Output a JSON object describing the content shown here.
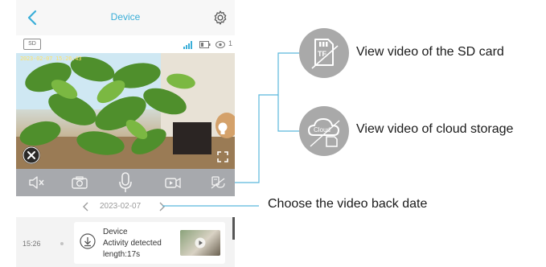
{
  "header": {
    "title": "Device",
    "back_icon": "chevron-left-icon",
    "settings_icon": "gear-icon"
  },
  "status": {
    "sd_label": "SD",
    "viewer_count": "1"
  },
  "video": {
    "timestamp": "2023-02-07 15:26:43"
  },
  "toolbar": {
    "icons": [
      "speaker-mute-icon",
      "camera-icon",
      "microphone-icon",
      "video-record-icon",
      "playback-icon"
    ]
  },
  "date_nav": {
    "date": "2023-02-07"
  },
  "events": [
    {
      "time": "15:26",
      "device": "Device",
      "description": "Activity detected",
      "length": "length:17s"
    }
  ],
  "callouts": {
    "sd": "View video of the SD card",
    "cloud": "View video of cloud storage",
    "date": "Choose the video back date",
    "sd_icon_text": "TF",
    "cloud_icon_text": "Cloud"
  },
  "colors": {
    "accent": "#3aaed8",
    "toolbar": "#a7a9ad",
    "leader_line": "#5ab8dc",
    "callout_circle": "#a9a9a9"
  }
}
